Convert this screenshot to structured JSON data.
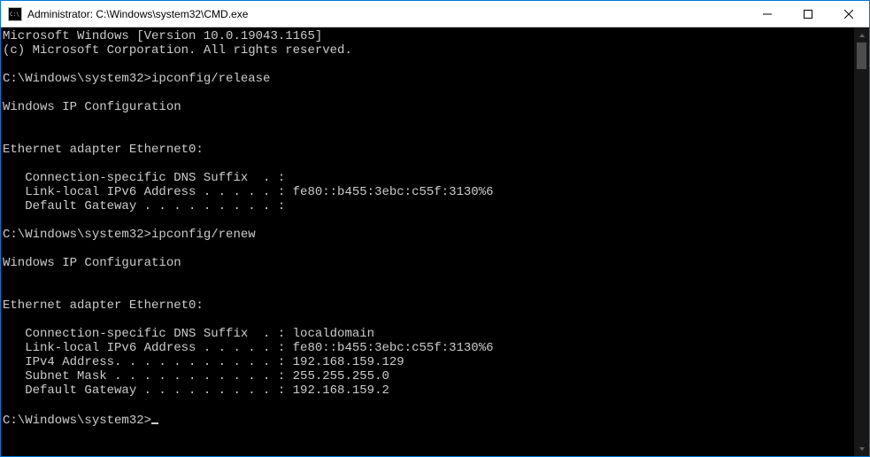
{
  "titlebar": {
    "title": "Administrator: C:\\Windows\\system32\\CMD.exe"
  },
  "console": {
    "banner_line1": "Microsoft Windows [Version 10.0.19043.1165]",
    "banner_line2": "(c) Microsoft Corporation. All rights reserved.",
    "prompt1": "C:\\Windows\\system32>",
    "cmd1": "ipconfig/release",
    "header1": "Windows IP Configuration",
    "adapter1_title": "Ethernet adapter Ethernet0:",
    "adapter1_dns": "   Connection-specific DNS Suffix  . :",
    "adapter1_ipv6": "   Link-local IPv6 Address . . . . . : fe80::b455:3ebc:c55f:3130%6",
    "adapter1_gw": "   Default Gateway . . . . . . . . . :",
    "prompt2": "C:\\Windows\\system32>",
    "cmd2": "ipconfig/renew",
    "header2": "Windows IP Configuration",
    "adapter2_title": "Ethernet adapter Ethernet0:",
    "adapter2_dns": "   Connection-specific DNS Suffix  . : localdomain",
    "adapter2_ipv6": "   Link-local IPv6 Address . . . . . : fe80::b455:3ebc:c55f:3130%6",
    "adapter2_ipv4": "   IPv4 Address. . . . . . . . . . . : 192.168.159.129",
    "adapter2_mask": "   Subnet Mask . . . . . . . . . . . : 255.255.255.0",
    "adapter2_gw": "   Default Gateway . . . . . . . . . : 192.168.159.2",
    "prompt3": "C:\\Windows\\system32>"
  }
}
